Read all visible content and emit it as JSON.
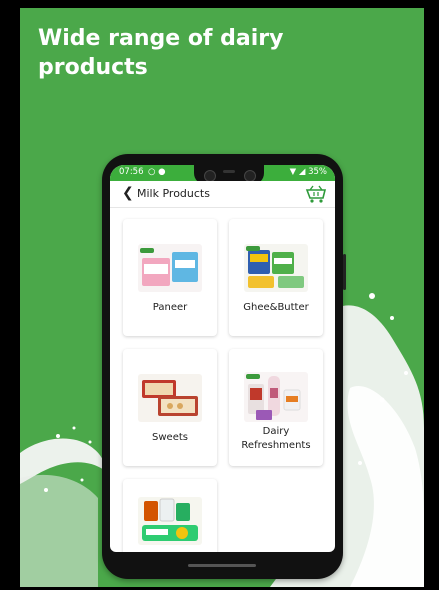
{
  "headline": "Wide range of dairy products",
  "status": {
    "time": "07:56",
    "battery": "35%"
  },
  "appbar": {
    "back_icon": "chevron-left-icon",
    "title": "Milk Products",
    "cart_icon": "cart-icon"
  },
  "categories": [
    {
      "label": "Paneer"
    },
    {
      "label": "Ghee&Butter"
    },
    {
      "label": "Sweets"
    },
    {
      "label_line1": "Dairy",
      "label_line2": "Refreshments"
    },
    {
      "label": ""
    }
  ],
  "colors": {
    "background": "#4ba84a",
    "statusbar": "#3cae3c",
    "accent_green": "#2e9a3a"
  }
}
